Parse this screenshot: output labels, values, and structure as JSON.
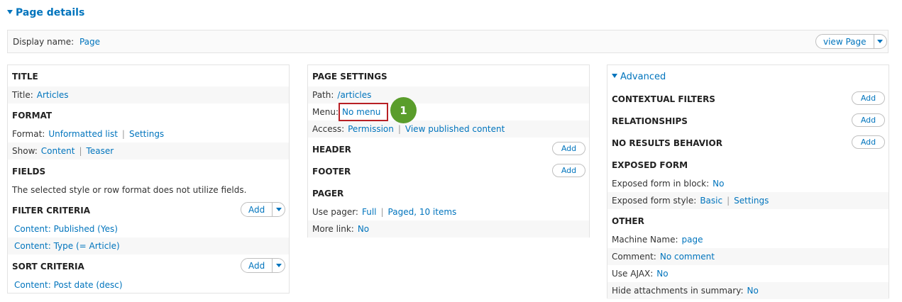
{
  "header": {
    "title": "Page details"
  },
  "display": {
    "label": "Display name:",
    "value": "Page",
    "view_button": "view Page"
  },
  "col1": {
    "title_heading": "TITLE",
    "title_label": "Title:",
    "title_value": "Articles",
    "format_heading": "FORMAT",
    "format_label": "Format:",
    "format_value": "Unformatted list",
    "format_settings": "Settings",
    "show_label": "Show:",
    "show_value": "Content",
    "show_mode": "Teaser",
    "fields_heading": "FIELDS",
    "fields_note": "The selected style or row format does not utilize fields.",
    "filter_heading": "FILTER CRITERIA",
    "filter_add": "Add",
    "filter_1": "Content: Published (Yes)",
    "filter_2": "Content: Type (= Article)",
    "sort_heading": "SORT CRITERIA",
    "sort_add": "Add",
    "sort_1": "Content: Post date (desc)"
  },
  "col2": {
    "page_settings_heading": "PAGE SETTINGS",
    "path_label": "Path:",
    "path_value": "/articles",
    "menu_label": "Menu:",
    "menu_value": "No menu",
    "access_label": "Access:",
    "access_value": "Permission",
    "access_perm": "View published content",
    "header_heading": "HEADER",
    "header_add": "Add",
    "footer_heading": "FOOTER",
    "footer_add": "Add",
    "pager_heading": "PAGER",
    "use_pager_label": "Use pager:",
    "use_pager_value": "Full",
    "use_pager_detail": "Paged, 10 items",
    "more_link_label": "More link:",
    "more_link_value": "No"
  },
  "col3": {
    "advanced_label": "Advanced",
    "contextual_heading": "CONTEXTUAL FILTERS",
    "contextual_add": "Add",
    "relationships_heading": "RELATIONSHIPS",
    "relationships_add": "Add",
    "no_results_heading": "NO RESULTS BEHAVIOR",
    "no_results_add": "Add",
    "exposed_heading": "EXPOSED FORM",
    "exposed_block_label": "Exposed form in block:",
    "exposed_block_value": "No",
    "exposed_style_label": "Exposed form style:",
    "exposed_style_value": "Basic",
    "exposed_style_settings": "Settings",
    "other_heading": "OTHER",
    "machine_label": "Machine Name:",
    "machine_value": "page",
    "comment_label": "Comment:",
    "comment_value": "No comment",
    "ajax_label": "Use AJAX:",
    "ajax_value": "No",
    "hide_attach_label": "Hide attachments in summary:",
    "hide_attach_value": "No"
  },
  "annotation": {
    "badge": "1"
  },
  "colors": {
    "link": "#0074bd",
    "highlight": "#b82025",
    "badge": "#5a9d2b"
  }
}
